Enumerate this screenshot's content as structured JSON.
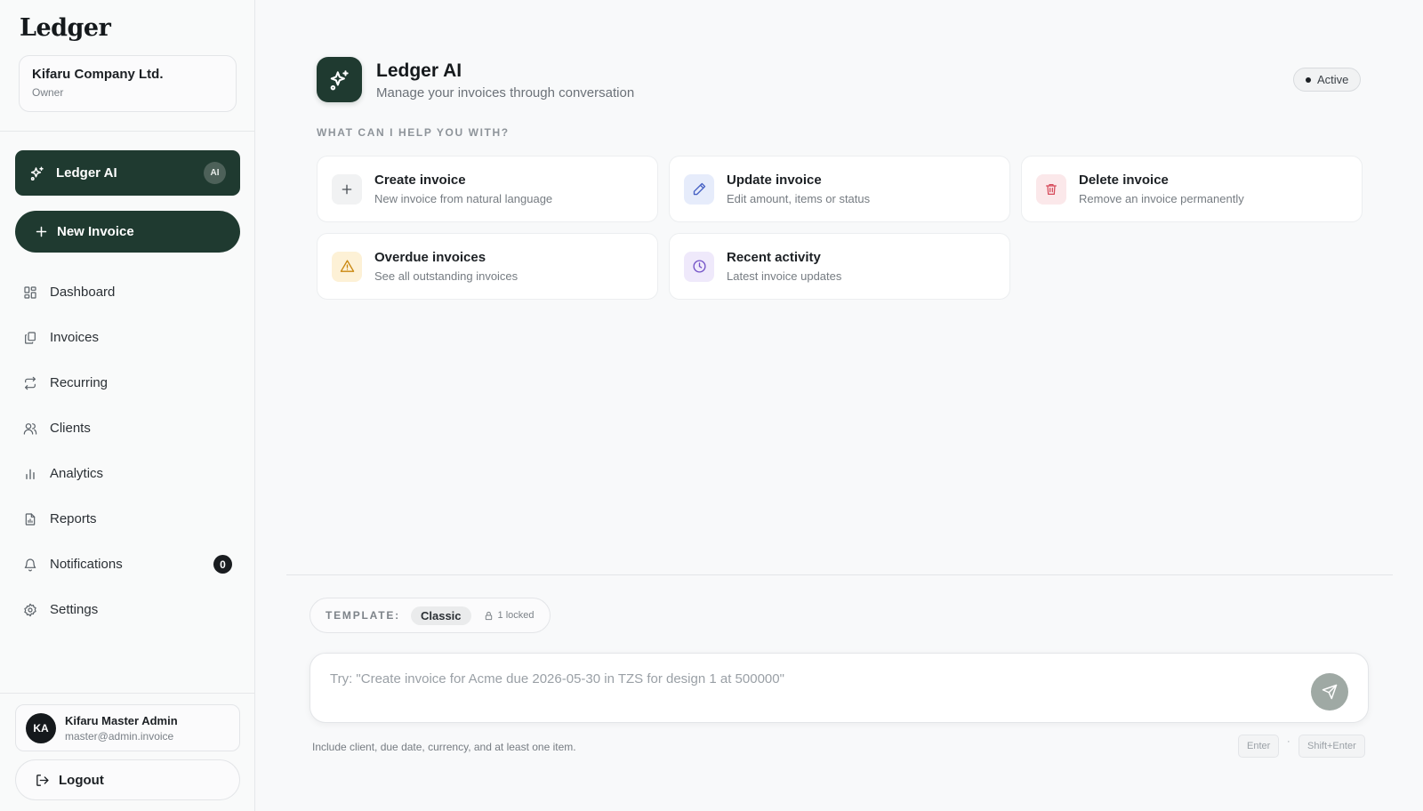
{
  "sidebar": {
    "brand": "Ledger",
    "company": {
      "name": "Kifaru Company Ltd.",
      "role": "Owner"
    },
    "ai_item": {
      "label": "Ledger AI",
      "badge": "AI"
    },
    "new_invoice": {
      "label": "New Invoice"
    },
    "nav": [
      {
        "label": "Dashboard",
        "icon": "dashboard-icon"
      },
      {
        "label": "Invoices",
        "icon": "invoices-icon"
      },
      {
        "label": "Recurring",
        "icon": "recurring-icon"
      },
      {
        "label": "Clients",
        "icon": "clients-icon"
      },
      {
        "label": "Analytics",
        "icon": "analytics-icon"
      },
      {
        "label": "Reports",
        "icon": "reports-icon"
      },
      {
        "label": "Notifications",
        "icon": "bell-icon",
        "badge": "0"
      },
      {
        "label": "Settings",
        "icon": "gear-icon"
      }
    ],
    "user": {
      "initials": "KA",
      "name": "Kifaru Master Admin",
      "email": "master@admin.invoice"
    },
    "logout": {
      "label": "Logout"
    }
  },
  "header": {
    "title": "Ledger AI",
    "subtitle": "Manage your invoices through conversation",
    "status": "Active"
  },
  "section_label": "WHAT CAN I HELP YOU WITH?",
  "cards": [
    {
      "title": "Create invoice",
      "desc": "New invoice from natural language",
      "icon": "plus-icon",
      "tone": "#f1f2f3",
      "fg": "#4a5056"
    },
    {
      "title": "Update invoice",
      "desc": "Edit amount, items or status",
      "icon": "pencil-icon",
      "tone": "#e6ecfb",
      "fg": "#4560c4"
    },
    {
      "title": "Delete invoice",
      "desc": "Remove an invoice permanently",
      "icon": "trash-icon",
      "tone": "#fbe8ea",
      "fg": "#d64a5a"
    },
    {
      "title": "Overdue invoices",
      "desc": "See all outstanding invoices",
      "icon": "warning-icon",
      "tone": "#fdf1d6",
      "fg": "#c9870e"
    },
    {
      "title": "Recent activity",
      "desc": "Latest invoice updates",
      "icon": "clock-icon",
      "tone": "#efe9fb",
      "fg": "#7352c7"
    }
  ],
  "composer": {
    "template_label": "TEMPLATE:",
    "template_value": "Classic",
    "locked_text": "1 locked",
    "placeholder": "Try: \"Create invoice for Acme due 2026-05-30 in TZS for design 1 at 500000\"",
    "hint": "Include client, due date, currency, and at least one item.",
    "enter_key": "Enter",
    "separator": "·",
    "shift_enter_key": "Shift+Enter"
  },
  "colors": {
    "accent": "#1f3a30",
    "send_button": "#9fa9a4"
  }
}
